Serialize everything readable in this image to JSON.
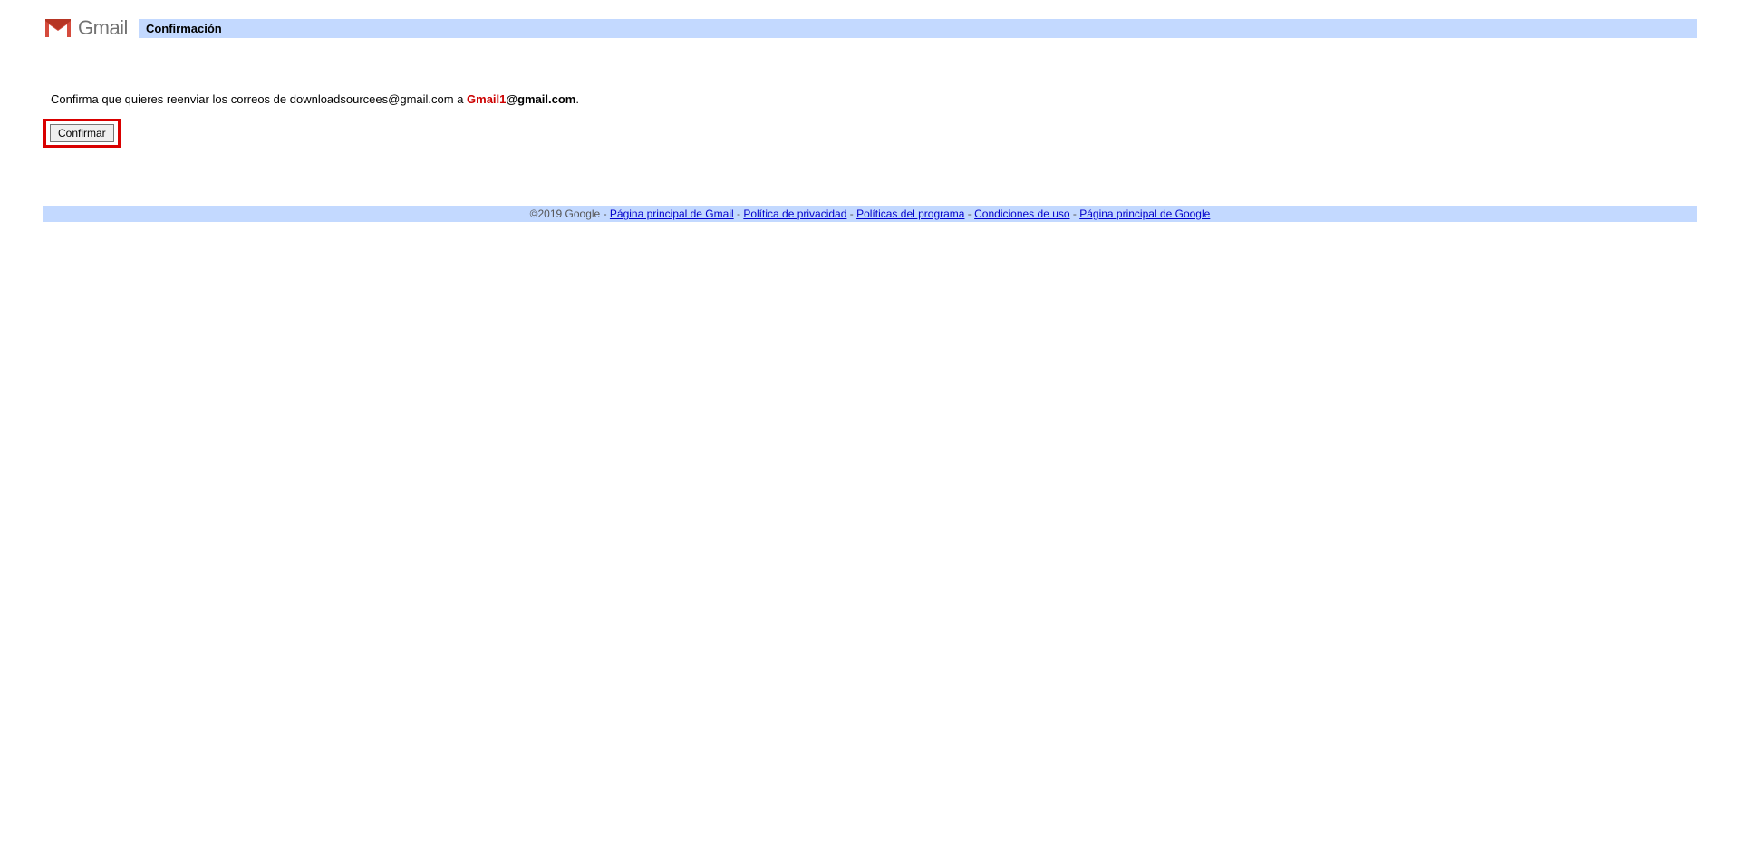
{
  "header": {
    "logo_text": "Gmail",
    "title": "Confirmación"
  },
  "content": {
    "prefix_text": "Confirma que quieres reenviar los correos de downloadsourcees@gmail.com a  ",
    "highlight_red": "Gmail1",
    "highlight_bold": "@gmail.com",
    "suffix": ".",
    "button_label": "Confirmar"
  },
  "footer": {
    "copyright": "©2019 Google",
    "separator": " - ",
    "links": {
      "gmail_home": "Página principal de Gmail",
      "privacy": "Política de privacidad",
      "program_policies": "Políticas del programa",
      "terms": "Condiciones de uso",
      "google_home": "Página principal de Google"
    }
  }
}
